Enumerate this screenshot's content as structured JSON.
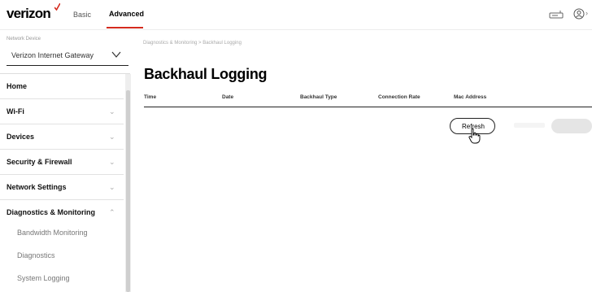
{
  "header": {
    "logo": "verizon",
    "nav": {
      "basic": "Basic",
      "advanced": "Advanced"
    },
    "icons": [
      "router-icon",
      "account-icon"
    ]
  },
  "sidebar": {
    "network_label": "Network Device",
    "network_select": "Verizon Internet Gateway",
    "items": [
      {
        "label": "Home"
      },
      {
        "label": "Wi-Fi"
      },
      {
        "label": "Devices"
      },
      {
        "label": "Security & Firewall"
      },
      {
        "label": "Network Settings"
      },
      {
        "label": "Diagnostics & Monitoring"
      }
    ],
    "subitems": [
      {
        "label": "Bandwidth Monitoring"
      },
      {
        "label": "Diagnostics"
      },
      {
        "label": "System Logging"
      }
    ]
  },
  "main": {
    "breadcrumb": "Diagnostics & Monitoring > Backhaul Logging",
    "title": "Backhaul Logging",
    "columns": [
      "Time",
      "Date",
      "Backhaul Type",
      "Connection Rate",
      "Mac Address"
    ],
    "refresh_label": "Refresh"
  },
  "colors": {
    "accent": "#d52b1e",
    "text": "#000000",
    "muted": "#9a9a9a"
  }
}
